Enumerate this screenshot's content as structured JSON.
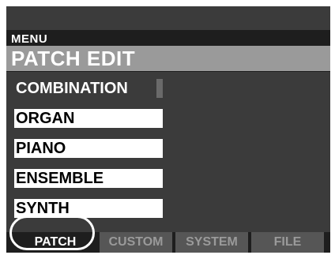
{
  "header": {
    "menu_label": "MENU",
    "title": "PATCH EDIT"
  },
  "menu": {
    "items": [
      {
        "label": "COMBINATION",
        "selected": true
      },
      {
        "label": "ORGAN",
        "selected": false
      },
      {
        "label": "PIANO",
        "selected": false
      },
      {
        "label": "ENSEMBLE",
        "selected": false
      },
      {
        "label": "SYNTH",
        "selected": false
      }
    ]
  },
  "tabs": [
    {
      "label": "PATCH",
      "active": true
    },
    {
      "label": "CUSTOM",
      "active": false
    },
    {
      "label": "SYSTEM",
      "active": false
    },
    {
      "label": "FILE",
      "active": false
    }
  ],
  "colors": {
    "screen_bg": "#3b3b3b",
    "title_bg": "#9a9a9a",
    "tab_bg": "#565656",
    "text_white": "#ffffff"
  }
}
